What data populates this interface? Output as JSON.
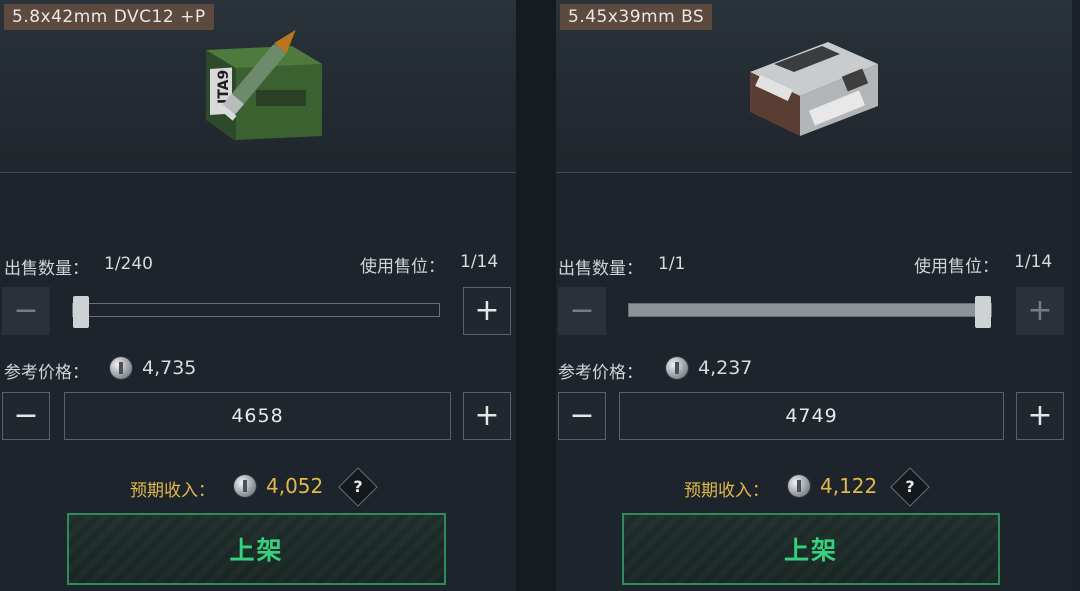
{
  "left": {
    "item_name": "5.8x42mm DVC12 +P",
    "sell_qty_label": "出售数量：",
    "sell_qty_value": "1/240",
    "slot_label": "使用售位：",
    "slot_value": "1/14",
    "slider_fraction": 0.0,
    "ref_price_label": "参考价格：",
    "ref_price_value": "4,735",
    "price_input": "4658",
    "income_label": "预期收入：",
    "income_value": "4,052",
    "help_symbol": "?",
    "list_button": "上架",
    "minus_symbol": "−",
    "plus_symbol": "+"
  },
  "right": {
    "item_name": "5.45x39mm BS",
    "sell_qty_label": "出售数量：",
    "sell_qty_value": "1/1",
    "slot_label": "使用售位：",
    "slot_value": "1/14",
    "slider_fraction": 1.0,
    "ref_price_label": "参考价格：",
    "ref_price_value": "4,237",
    "price_input": "4749",
    "income_label": "预期收入：",
    "income_value": "4,122",
    "help_symbol": "?",
    "list_button": "上架",
    "minus_symbol": "−",
    "plus_symbol": "+"
  },
  "colors": {
    "income": "#e3b94a",
    "list_button_text": "#34d27c",
    "list_button_border": "#2f8a5c",
    "name_tag": "#5c4a3e"
  },
  "icons": [
    "coin-icon",
    "minus-icon",
    "plus-icon",
    "help-icon",
    "ammo-box-icon",
    "bullet-icon"
  ]
}
